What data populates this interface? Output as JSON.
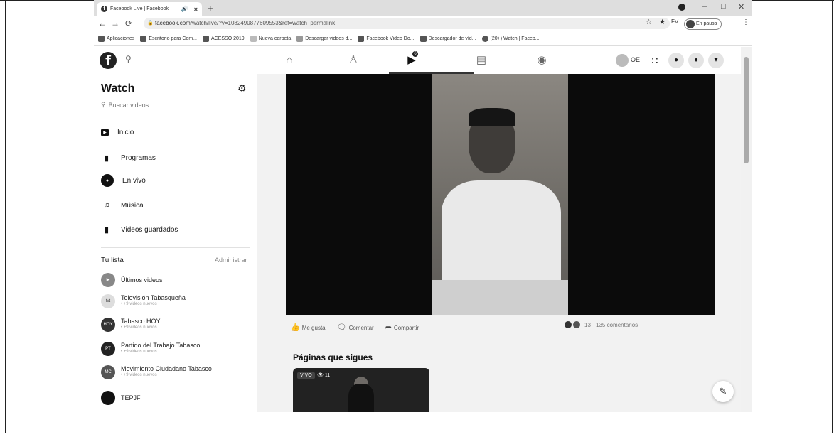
{
  "browser": {
    "tab_title": "Facebook Live | Facebook",
    "new_tab_label": "+",
    "url_host": "facebook.com",
    "url_path": "/watch/live/?v=1082490877609553&ref=watch_permalink",
    "paused_label": "En pausa",
    "bookmarks": [
      "Aplicaciones",
      "Escritorio para Com...",
      "ACESSO 2019",
      "Nueva carpeta",
      "Descargar videos d...",
      "Facebook Video Do...",
      "Descargador de víd...",
      "(20+) Watch | Faceb..."
    ]
  },
  "fbnav": {
    "profile_initials": "OE",
    "watch_badge": "6"
  },
  "sidebar": {
    "title": "Watch",
    "search_placeholder": "Buscar videos",
    "menu": [
      {
        "label": "Inicio",
        "icon": "play-icon"
      },
      {
        "label": "Programas",
        "icon": "clapper-icon"
      },
      {
        "label": "En vivo",
        "icon": "live-icon"
      },
      {
        "label": "Música",
        "icon": "music-icon"
      },
      {
        "label": "Videos guardados",
        "icon": "bookmark-icon"
      }
    ],
    "list_title": "Tu lista",
    "list_admin": "Administrar",
    "pages": [
      {
        "name": "Últimos videos",
        "sub": ""
      },
      {
        "name": "Televisión Tabasqueña",
        "sub": "• +9 videos nuevos"
      },
      {
        "name": "Tabasco HOY",
        "sub": "• +9 videos nuevos"
      },
      {
        "name": "Partido del Trabajo Tabasco",
        "sub": "• +9 videos nuevos"
      },
      {
        "name": "Movimiento Ciudadano Tabasco",
        "sub": "• +9 videos nuevos"
      },
      {
        "name": "TEPJF",
        "sub": ""
      }
    ]
  },
  "main": {
    "actions": {
      "like": "Me gusta",
      "comment": "Comentar",
      "share": "Compartir"
    },
    "reactions_text": "13 · 135 comentarios",
    "following_title": "Páginas que sigues",
    "thumb_live": "VIVO",
    "thumb_viewers": "11"
  }
}
